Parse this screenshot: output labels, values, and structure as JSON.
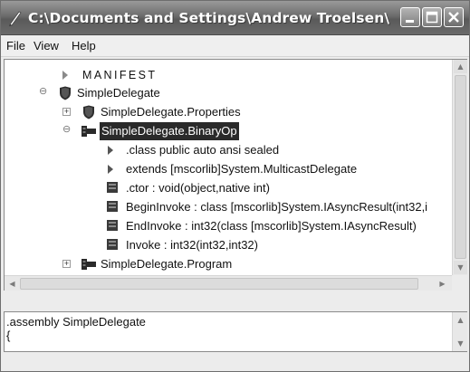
{
  "window": {
    "title": "C:\\Documents and Settings\\Andrew Troelsen\\M..."
  },
  "menu": {
    "file": "File",
    "view": "View",
    "help": "Help"
  },
  "tree": {
    "manifest": "MANIFEST",
    "root": "SimpleDelegate",
    "properties": "SimpleDelegate.Properties",
    "binaryop": "SimpleDelegate.BinaryOp",
    "class_decl": ".class public auto ansi sealed",
    "extends": "extends [mscorlib]System.MulticastDelegate",
    "ctor": ".ctor : void(object,native int)",
    "begin_invoke": "BeginInvoke : class [mscorlib]System.IAsyncResult(int32,i",
    "end_invoke": "EndInvoke : int32(class [mscorlib]System.IAsyncResult)",
    "invoke": "Invoke : int32(int32,int32)",
    "program": "SimpleDelegate.Program"
  },
  "il": {
    "line1": ".assembly SimpleDelegate",
    "line2": "{"
  },
  "colors": {
    "selection": "#2a2a2a",
    "titlebar": "#6c6c6c"
  }
}
